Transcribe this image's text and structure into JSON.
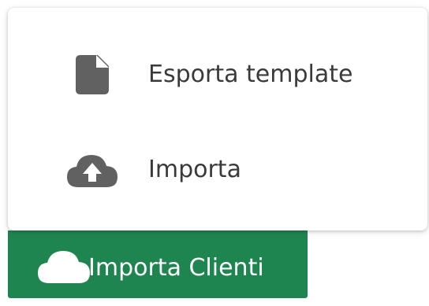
{
  "menu": {
    "items": [
      {
        "label": "Esporta template",
        "icon": "file-icon"
      },
      {
        "label": "Importa",
        "icon": "cloud-upload-icon"
      }
    ]
  },
  "button": {
    "label": "Importa Clienti",
    "icon": "cloud-icon"
  },
  "colors": {
    "button_bg": "#1f8550",
    "icon_gray": "#616161",
    "text": "#3a3a3a"
  }
}
